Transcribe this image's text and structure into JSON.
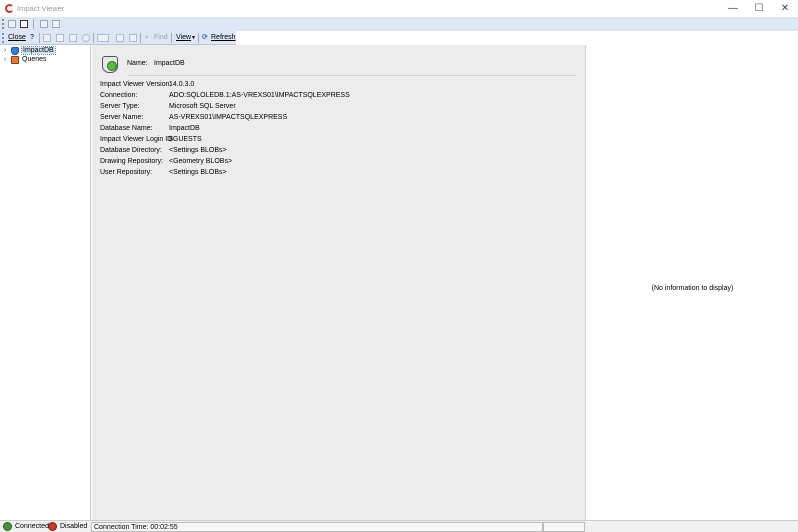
{
  "window": {
    "title": "Impact Viewer",
    "minimize_glyph": "—",
    "maximize_glyph": "☐",
    "close_glyph": "✕"
  },
  "toolbar": {
    "close_label": "Close",
    "help_label": "?",
    "find_label": "Find",
    "view_label": "View",
    "refresh_label": "Refresh"
  },
  "tree": {
    "items": [
      {
        "label": "ImpactDB",
        "icon": "database-icon",
        "selected": true
      },
      {
        "label": "Queries",
        "icon": "queries-icon",
        "selected": false
      }
    ]
  },
  "details": {
    "name_label": "Name:",
    "name_value": "ImpactDB",
    "properties": [
      {
        "key": "Impact Viewer Version:",
        "value": "14.0.3.0"
      },
      {
        "key": "Connection:",
        "value": "ADO:SQLOLEDB.1:AS-VREXS01\\IMPACTSQLEXPRESS"
      },
      {
        "key": "Server Type:",
        "value": "Microsoft SQL Server"
      },
      {
        "key": "Server Name:",
        "value": "AS-VREXS01\\IMPACTSQLEXPRESS"
      },
      {
        "key": "Database Name:",
        "value": "ImpactDB"
      },
      {
        "key": "Impact Viewer Login ID",
        "value": "$GUESTS"
      },
      {
        "key": "Database Directory:",
        "value": "<Settings BLOBs>"
      },
      {
        "key": "Drawing Repository:",
        "value": "<Geometry BLOBs>"
      },
      {
        "key": "User Repository:",
        "value": "<Settings BLOBs>"
      }
    ]
  },
  "info_panel": {
    "empty_text": "(No information to display)"
  },
  "status": {
    "connected": "Connected",
    "disabled": "Disabled",
    "connection_time": "Connection Time: 00:02:55"
  },
  "colors": {
    "toolbar_bg": "#dce6f4",
    "accent": "#3a7bd5"
  }
}
